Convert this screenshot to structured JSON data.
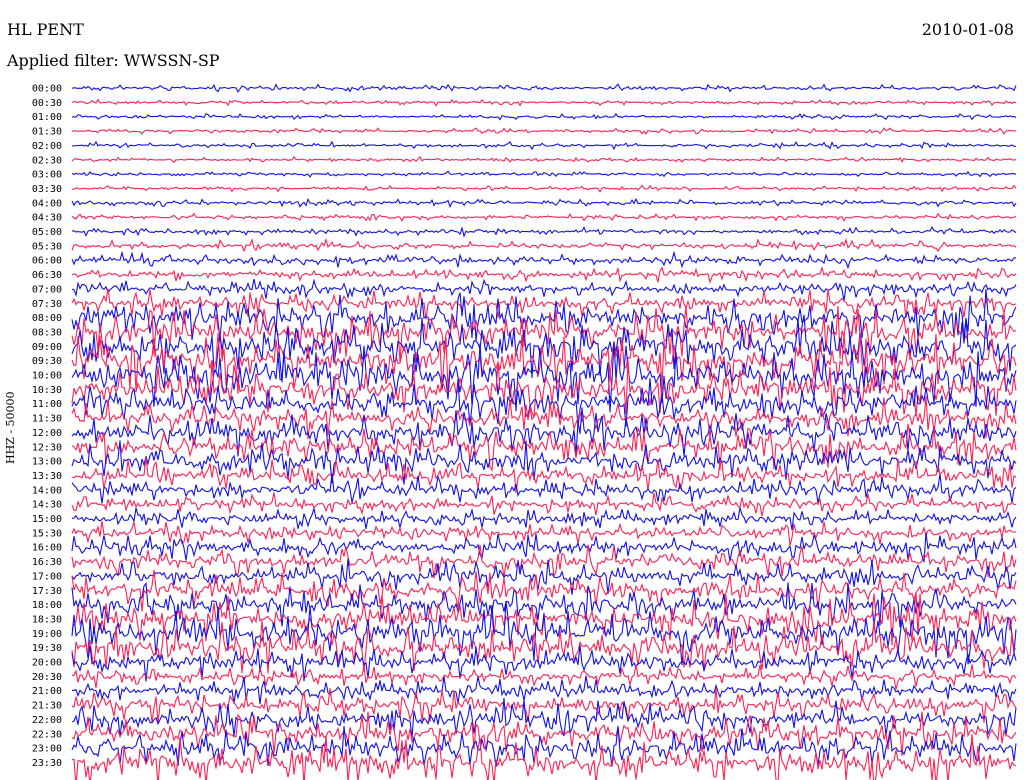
{
  "header": {
    "station": "HL PENT",
    "date": "2010-01-08",
    "filter": "Applied filter: WWSSN-SP"
  },
  "colors": {
    "a": "#1010e8",
    "b": "#ff2050",
    "text": "#000000",
    "background": "#ffffff"
  },
  "chart_data": {
    "type": "line",
    "description_type": "helicorder",
    "ylabel": "HHZ - 50000",
    "title": "",
    "xlabel": "",
    "grid": false,
    "series_colors": [
      "#1010e8",
      "#ff2050"
    ],
    "rows": [
      {
        "label": "00:00",
        "amp": 1.2
      },
      {
        "label": "00:30",
        "amp": 1.0
      },
      {
        "label": "01:00",
        "amp": 1.0
      },
      {
        "label": "01:30",
        "amp": 1.0
      },
      {
        "label": "02:00",
        "amp": 1.2
      },
      {
        "label": "02:30",
        "amp": 1.0
      },
      {
        "label": "03:00",
        "amp": 1.0
      },
      {
        "label": "03:30",
        "amp": 1.0
      },
      {
        "label": "04:00",
        "amp": 1.5
      },
      {
        "label": "04:30",
        "amp": 1.2
      },
      {
        "label": "05:00",
        "amp": 1.5
      },
      {
        "label": "05:30",
        "amp": 2.0
      },
      {
        "label": "06:00",
        "amp": 2.5
      },
      {
        "label": "06:30",
        "amp": 2.5
      },
      {
        "label": "07:00",
        "amp": 3.5
      },
      {
        "label": "07:30",
        "amp": 5.0
      },
      {
        "label": "08:00",
        "amp": 9.0
      },
      {
        "label": "08:30",
        "amp": 10.0
      },
      {
        "label": "09:00",
        "amp": 12.0
      },
      {
        "label": "09:30",
        "amp": 12.0
      },
      {
        "label": "10:00",
        "amp": 12.0
      },
      {
        "label": "10:30",
        "amp": 10.0
      },
      {
        "label": "11:00",
        "amp": 8.0
      },
      {
        "label": "11:30",
        "amp": 7.0
      },
      {
        "label": "12:00",
        "amp": 8.0
      },
      {
        "label": "12:30",
        "amp": 8.0
      },
      {
        "label": "13:00",
        "amp": 7.0
      },
      {
        "label": "13:30",
        "amp": 6.0
      },
      {
        "label": "14:00",
        "amp": 5.0
      },
      {
        "label": "14:30",
        "amp": 4.0
      },
      {
        "label": "15:00",
        "amp": 4.0
      },
      {
        "label": "15:30",
        "amp": 4.0
      },
      {
        "label": "16:00",
        "amp": 5.0
      },
      {
        "label": "16:30",
        "amp": 5.5
      },
      {
        "label": "17:00",
        "amp": 6.0
      },
      {
        "label": "17:30",
        "amp": 7.0
      },
      {
        "label": "18:00",
        "amp": 8.0
      },
      {
        "label": "18:30",
        "amp": 9.0
      },
      {
        "label": "19:00",
        "amp": 10.0
      },
      {
        "label": "19:30",
        "amp": 9.0
      },
      {
        "label": "20:00",
        "amp": 6.0
      },
      {
        "label": "20:30",
        "amp": 4.0
      },
      {
        "label": "21:00",
        "amp": 5.0
      },
      {
        "label": "21:30",
        "amp": 6.0
      },
      {
        "label": "22:00",
        "amp": 7.0
      },
      {
        "label": "22:30",
        "amp": 8.0
      },
      {
        "label": "23:00",
        "amp": 8.0
      },
      {
        "label": "23:30",
        "amp": 9.0
      }
    ]
  }
}
